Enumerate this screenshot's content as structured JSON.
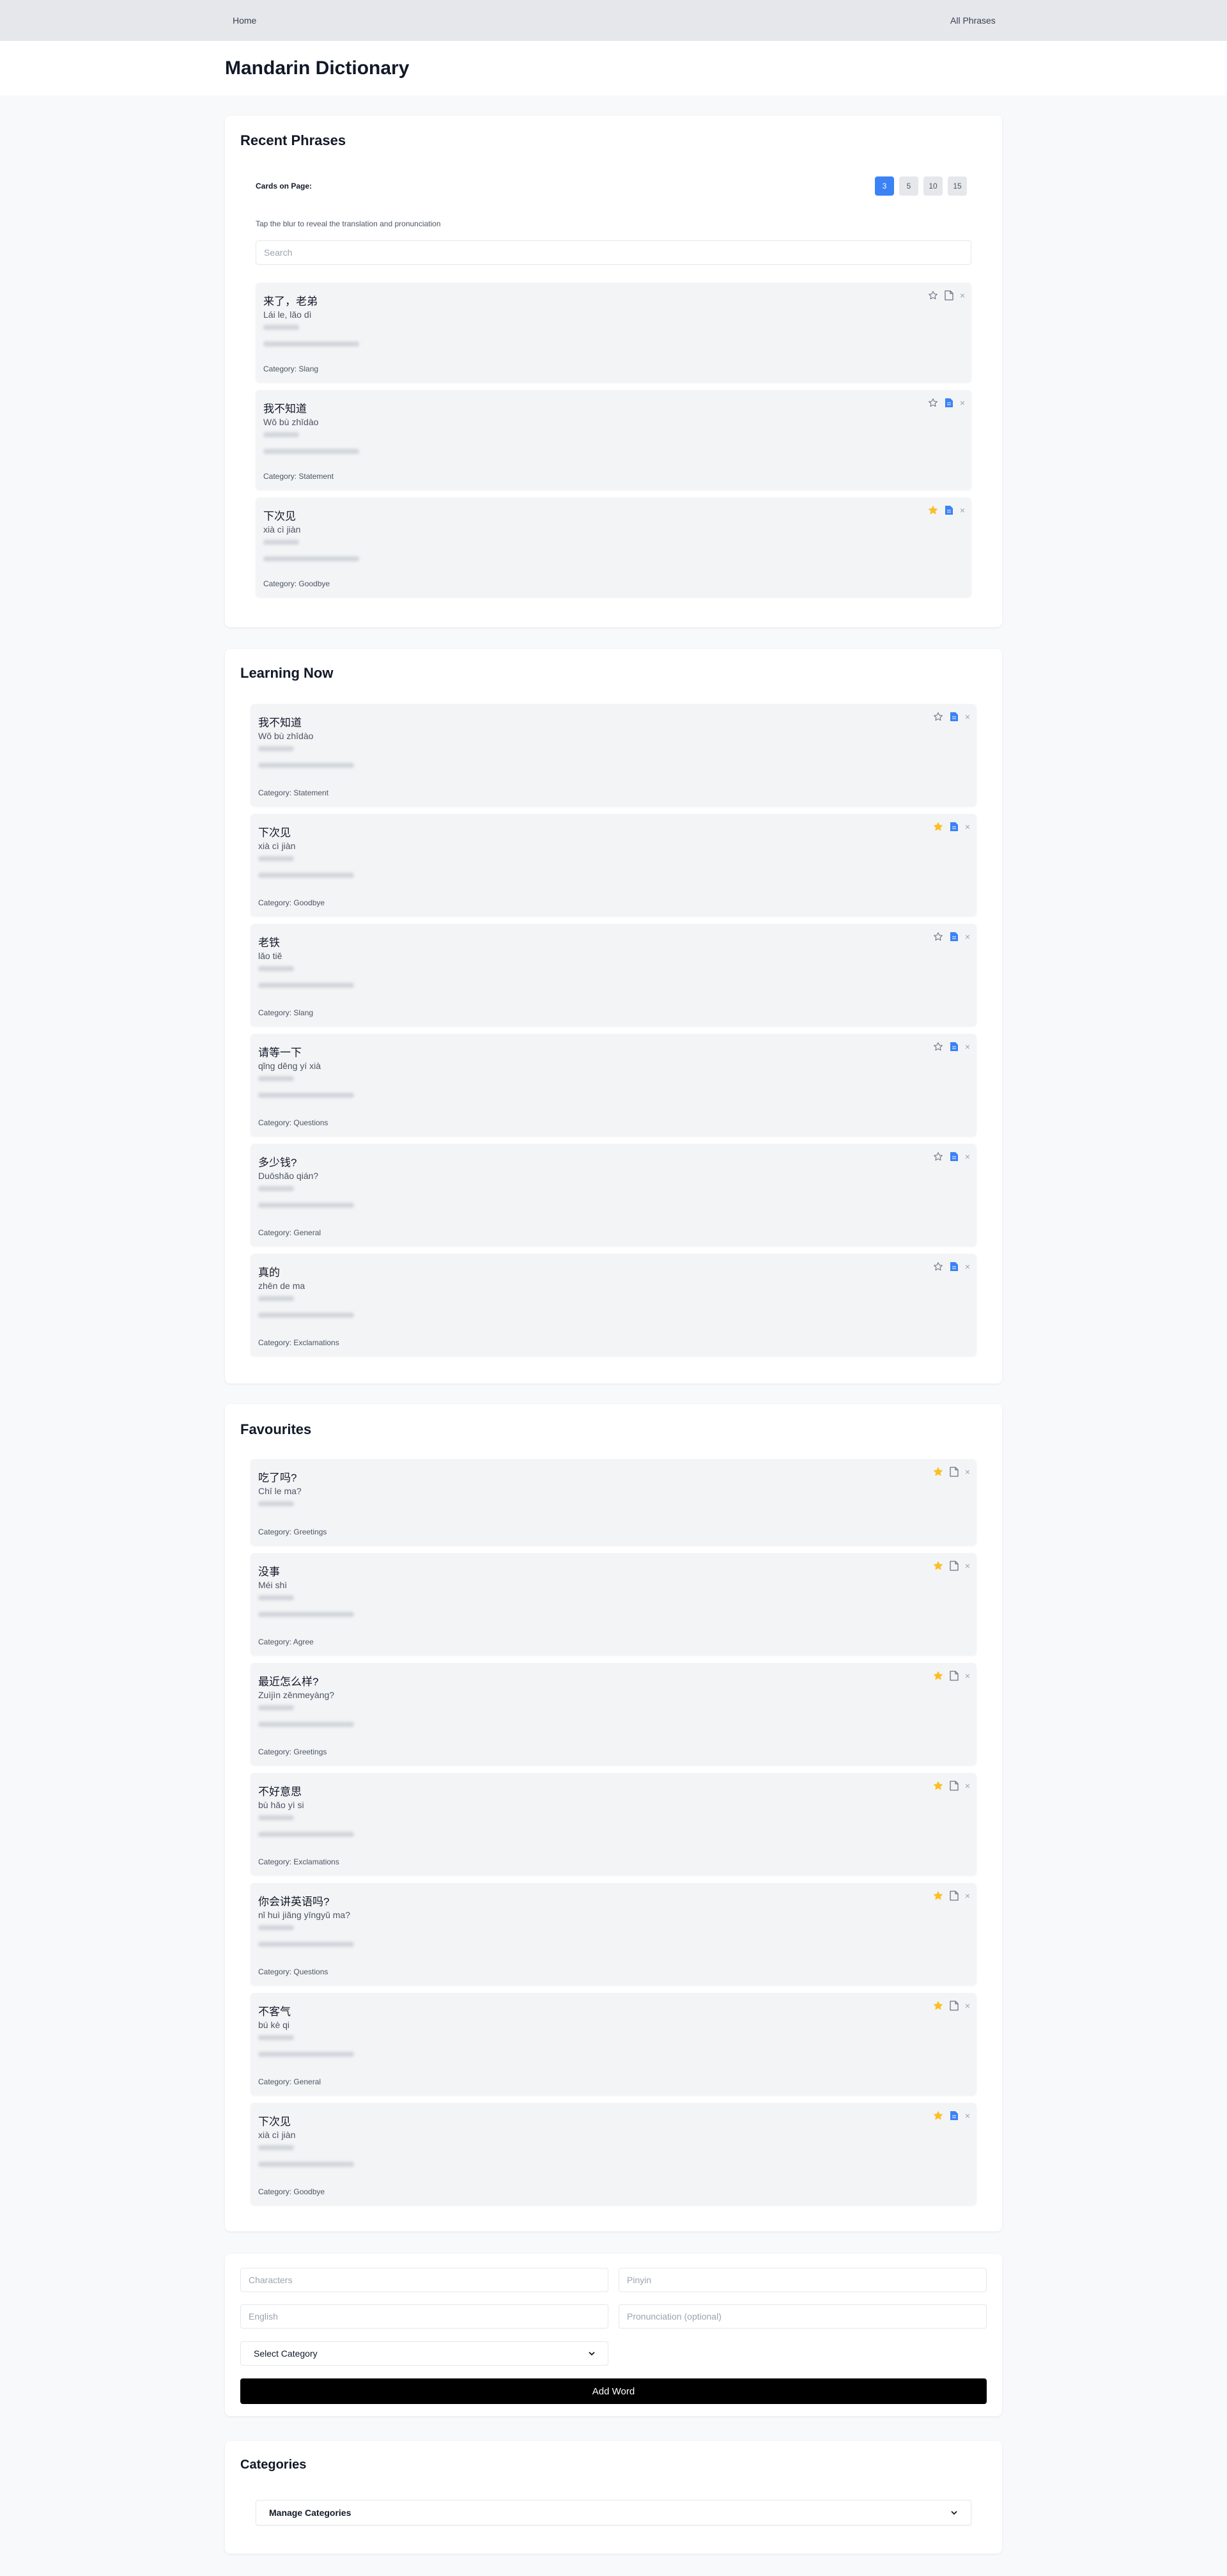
{
  "nav": {
    "home": "Home",
    "all_phrases": "All Phrases"
  },
  "header": {
    "title": "Mandarin Dictionary"
  },
  "recent": {
    "title": "Recent Phrases",
    "cards_label": "Cards on Page:",
    "page_sizes": [
      "3",
      "5",
      "10",
      "15"
    ],
    "active_page_size": "3",
    "hint": "Tap the blur to reveal the translation and pronunciation",
    "search_placeholder": "Search",
    "cards": [
      {
        "chars": "来了，老弟",
        "pinyin": "Lái le, lǎo dì",
        "category": "Category: Slang",
        "starred": false,
        "saved": false
      },
      {
        "chars": "我不知道",
        "pinyin": "Wǒ bù zhīdào",
        "category": "Category: Statement",
        "starred": false,
        "saved": true
      },
      {
        "chars": "下次见",
        "pinyin": "xià cì jiàn",
        "category": "Category: Goodbye",
        "starred": true,
        "saved": true
      }
    ]
  },
  "learning": {
    "title": "Learning Now",
    "cards": [
      {
        "chars": "我不知道",
        "pinyin": "Wǒ bù zhīdào",
        "category": "Category: Statement",
        "starred": false,
        "saved": true
      },
      {
        "chars": "下次见",
        "pinyin": "xià cì jiàn",
        "category": "Category: Goodbye",
        "starred": true,
        "saved": true
      },
      {
        "chars": "老铁",
        "pinyin": "lǎo tiě",
        "category": "Category: Slang",
        "starred": false,
        "saved": true
      },
      {
        "chars": "请等一下",
        "pinyin": "qǐng děng yí xià",
        "category": "Category: Questions",
        "starred": false,
        "saved": true
      },
      {
        "chars": "多少钱?",
        "pinyin": "Duōshǎo qián?",
        "category": "Category: General",
        "starred": false,
        "saved": true
      },
      {
        "chars": "真的",
        "pinyin": "zhēn de ma",
        "category": "Category: Exclamations",
        "starred": false,
        "saved": true
      }
    ]
  },
  "favourites": {
    "title": "Favourites",
    "cards": [
      {
        "chars": "吃了吗?",
        "pinyin": "Chī le ma?",
        "category": "Category: Greetings",
        "starred": true,
        "saved": false,
        "short": true
      },
      {
        "chars": "没事",
        "pinyin": "Méi shì",
        "category": "Category: Agree",
        "starred": true,
        "saved": false
      },
      {
        "chars": "最近怎么样?",
        "pinyin": "Zuìjìn zěnmeyàng?",
        "category": "Category: Greetings",
        "starred": true,
        "saved": false
      },
      {
        "chars": "不好意思",
        "pinyin": "bù hǎo yì si",
        "category": "Category: Exclamations",
        "starred": true,
        "saved": false
      },
      {
        "chars": "你会讲英语吗?",
        "pinyin": "nǐ huì jiǎng yīngyǔ ma?",
        "category": "Category: Questions",
        "starred": true,
        "saved": false
      },
      {
        "chars": "不客气",
        "pinyin": "bú kè qi",
        "category": "Category: General",
        "starred": true,
        "saved": false
      },
      {
        "chars": "下次见",
        "pinyin": "xià cì jiàn",
        "category": "Category: Goodbye",
        "starred": true,
        "saved": true
      }
    ]
  },
  "form": {
    "characters_placeholder": "Characters",
    "pinyin_placeholder": "Pinyin",
    "english_placeholder": "English",
    "pronunciation_placeholder": "Pronunciation (optional)",
    "category_select": "Select Category",
    "add_button": "Add Word"
  },
  "categories": {
    "title": "Categories",
    "manage": "Manage Categories"
  },
  "colors": {
    "accent": "#3b82f6",
    "star": "#fbbf24",
    "card_bg": "#f3f4f6"
  }
}
